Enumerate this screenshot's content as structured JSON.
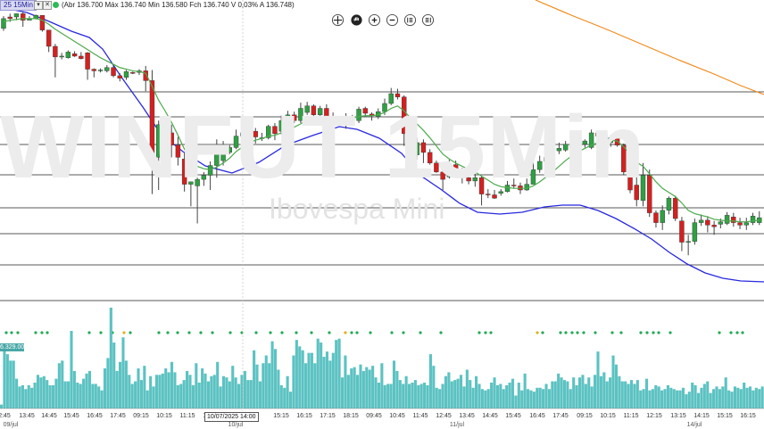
{
  "symbol_label": "WINFUT 15Min",
  "symbol_badge": "25 15Min",
  "ohlc_text": "(Abr 136.700 Máx 136.740 Min 136.580 Fch 136.740 V 0,03% A 136.748)",
  "watermark": "WINFUT 15Min",
  "watermark_sub": "Ibovespa Mini",
  "volume_badge": "6.329.00",
  "cursor_time": "10/07/2025 14:00",
  "toolbar": [
    "move-icon",
    "hand-icon",
    "zoom-in-icon",
    "zoom-out-icon",
    "fit-left-icon",
    "fit-right-icon"
  ],
  "x_ticks": [
    "2:45",
    "13:45",
    "14:45",
    "15:45",
    "16:45",
    "17:45",
    "09:15",
    "10:15",
    "11:15",
    "12:15",
    "14:00",
    "15:15",
    "16:15",
    "17:15",
    "18:15",
    "09:45",
    "10:45",
    "11:45",
    "12:45",
    "13:45",
    "14:45",
    "15:45",
    "16:45",
    "17:45",
    "09:15",
    "10:15",
    "11:15",
    "12:15",
    "13:15",
    "14:15",
    "15:15",
    "16:15"
  ],
  "x_dates": [
    "09/jul",
    "10/jul",
    "11/jul",
    "14/jul"
  ],
  "colors": {
    "up": "#2ea043",
    "down": "#d42020",
    "ma_fast": "#4daa4d",
    "ma_slow": "#2828e0",
    "ma_long": "#f08a1c",
    "volume": "#5cc2c2",
    "dot": "#22aa55",
    "dot_alt": "#e0b020"
  },
  "chart_data": {
    "type": "candlestick",
    "candles": [
      [
        -0.2,
        1.0,
        -0.5,
        1.3
      ],
      [
        1.2,
        1.0,
        0.6,
        1.6
      ],
      [
        1.2,
        1.6,
        0.8,
        1.6
      ],
      [
        1.6,
        0.8,
        0.0,
        1.8
      ],
      [
        0.8,
        1.0,
        0.8,
        1.3
      ],
      [
        1.0,
        1.4,
        0.9,
        1.5
      ],
      [
        1.4,
        -0.4,
        -0.6,
        1.4
      ],
      [
        -0.4,
        -2.4,
        -3.1,
        -0.4
      ],
      [
        -2.4,
        -3.7,
        -6.2,
        -2.1
      ],
      [
        -3.6,
        -3.6,
        -4.0,
        -3.2
      ],
      [
        -3.8,
        -3.1,
        -3.9,
        -2.9
      ],
      [
        -3.3,
        -3.6,
        -3.7,
        -3.0
      ],
      [
        -3.6,
        -3.9,
        -4.0,
        -3.1
      ],
      [
        -3.2,
        -5.2,
        -6.5,
        -3.1
      ],
      [
        -5.2,
        -5.4,
        -6.2,
        -5.1
      ],
      [
        -5.4,
        -5.3,
        -5.6,
        -5.1
      ],
      [
        -5.4,
        -5.0,
        -5.6,
        -4.7
      ],
      [
        -5.0,
        -6.0,
        -6.2,
        -4.7
      ],
      [
        -6.0,
        -6.3,
        -6.7,
        -5.7
      ],
      [
        -6.2,
        -5.5,
        -6.5,
        -5.3
      ],
      [
        -5.6,
        -5.7,
        -5.8,
        -5.5
      ],
      [
        -5.6,
        -5.4,
        -5.9,
        -5.2
      ],
      [
        -5.4,
        -6.6,
        -7.9,
        -4.8
      ],
      [
        -6.6,
        -17.0,
        -20.5,
        -5.3
      ],
      [
        -16.0,
        -12.0,
        -20.0,
        -11.5
      ],
      [
        -12.0,
        -12.8,
        -13.2,
        -11.0
      ],
      [
        -13.0,
        -14.5,
        -16.0,
        -12.0
      ],
      [
        -14.5,
        -16.0,
        -17.0,
        -13.5
      ],
      [
        -16.2,
        -19.3,
        -20.2,
        -15.5
      ],
      [
        -19.3,
        -19.0,
        -22.0,
        -19.0
      ],
      [
        -19.5,
        -18.7,
        -24.1,
        -18.5
      ],
      [
        -18.7,
        -18.2,
        -19.5,
        -17.8
      ],
      [
        -18.2,
        -17.0,
        -20.0,
        -16.5
      ],
      [
        -17.0,
        -15.0,
        -18.5,
        -13.8
      ],
      [
        -16.4,
        -14.9,
        -17.0,
        -14.0
      ],
      [
        -15.4,
        -14.8,
        -15.6,
        -14.5
      ],
      [
        -14.8,
        -13.4,
        -15.0,
        -12.6
      ],
      [
        -13.4,
        -13.0,
        -13.7,
        -12.7
      ],
      [
        -13.5,
        -12.8,
        -13.8,
        -12.5
      ],
      [
        -12.8,
        -13.5,
        -14.3,
        -12.4
      ],
      [
        -13.6,
        -13.6,
        -14.0,
        -13.0
      ],
      [
        -13.6,
        -12.2,
        -13.8,
        -12.0
      ],
      [
        -12.2,
        -13.1,
        -13.9,
        -11.8
      ],
      [
        -12.8,
        -11.5,
        -13.2,
        -10.9
      ],
      [
        -11.5,
        -10.8,
        -11.7,
        -10.3
      ],
      [
        -10.8,
        -11.5,
        -11.8,
        -10.4
      ],
      [
        -11.5,
        -10.0,
        -11.8,
        -9.3
      ],
      [
        -10.5,
        -9.7,
        -10.8,
        -9.2
      ],
      [
        -9.7,
        -10.8,
        -11.3,
        -9.5
      ],
      [
        -10.8,
        -10.0,
        -11.3,
        -9.7
      ],
      [
        -10.0,
        -11.3,
        -11.6,
        -9.5
      ],
      [
        -11.3,
        -11.3,
        -11.8,
        -10.5
      ],
      [
        -11.3,
        -11.6,
        -12.0,
        -11.2
      ],
      [
        -11.6,
        -11.1,
        -12.5,
        -10.6
      ],
      [
        -11.1,
        -11.5,
        -11.8,
        -10.8
      ],
      [
        -11.5,
        -10.1,
        -11.8,
        -9.8
      ],
      [
        -10.0,
        -10.6,
        -11.0,
        -9.8
      ],
      [
        -10.7,
        -10.9,
        -11.5,
        -10.5
      ],
      [
        -11.0,
        -10.4,
        -11.3,
        -10.0
      ],
      [
        -10.4,
        -9.4,
        -10.8,
        -8.8
      ],
      [
        -9.4,
        -8.2,
        -9.6,
        -7.5
      ],
      [
        -8.2,
        -8.6,
        -8.9,
        -7.6
      ],
      [
        -8.6,
        -13.1,
        -14.6,
        -8.4
      ],
      [
        -13.1,
        -15.7,
        -16.0,
        -12.5
      ],
      [
        -15.7,
        -14.2,
        -16.3,
        -13.6
      ],
      [
        -14.2,
        -15.4,
        -16.7,
        -13.8
      ],
      [
        -15.4,
        -16.7,
        -16.9,
        -15.0
      ],
      [
        -16.7,
        -17.8,
        -17.9,
        -16.4
      ],
      [
        -17.8,
        -18.7,
        -20.0,
        -17.5
      ],
      [
        -18.4,
        -16.9,
        -18.6,
        -16.3
      ],
      [
        -16.9,
        -17.5,
        -18.2,
        -16.4
      ],
      [
        -17.5,
        -18.5,
        -19.2,
        -17.3
      ],
      [
        -18.5,
        -18.9,
        -19.3,
        -18.0
      ],
      [
        -18.9,
        -18.5,
        -19.6,
        -18.0
      ],
      [
        -18.5,
        -20.5,
        -21.9,
        -18.3
      ],
      [
        -20.5,
        -20.6,
        -21.0,
        -19.9
      ],
      [
        -20.6,
        -21.0,
        -21.1,
        -20.0
      ],
      [
        -20.4,
        -20.2,
        -20.7,
        -19.9
      ],
      [
        -20.2,
        -19.4,
        -20.3,
        -18.9
      ],
      [
        -19.4,
        -19.5,
        -19.8,
        -18.6
      ],
      [
        -19.5,
        -20.0,
        -20.5,
        -19.1
      ],
      [
        -20.0,
        -19.3,
        -20.1,
        -18.6
      ],
      [
        -19.3,
        -17.5,
        -19.3,
        -16.6
      ],
      [
        -17.5,
        -16.5,
        -17.9,
        -15.8
      ],
      [
        -16.5,
        -16.0,
        -16.8,
        -15.7
      ],
      [
        -16.0,
        -15.2,
        -16.2,
        -14.8
      ],
      [
        -15.2,
        -14.9,
        -15.6,
        -14.2
      ],
      [
        -15.1,
        -14.4,
        -15.3,
        -14.0
      ],
      [
        -14.4,
        -14.8,
        -15.1,
        -14.1
      ],
      [
        -14.8,
        -14.4,
        -15.0,
        -14.2
      ],
      [
        -14.4,
        -14.0,
        -14.8,
        -13.8
      ],
      [
        -14.8,
        -13.0,
        -15.0,
        -12.6
      ],
      [
        -13.0,
        -13.4,
        -13.7,
        -12.8
      ],
      [
        -13.2,
        -14.0,
        -14.3,
        -13.0
      ],
      [
        -14.2,
        -13.6,
        -14.7,
        -13.3
      ],
      [
        -13.6,
        -14.5,
        -14.7,
        -13.2
      ],
      [
        -14.5,
        -17.8,
        -18.2,
        -14.3
      ],
      [
        -17.8,
        -20.0,
        -20.4,
        -17.5
      ],
      [
        -19.4,
        -21.2,
        -22.0,
        -17.0
      ],
      [
        -21.3,
        -18.2,
        -22.0,
        -16.7
      ],
      [
        -18.2,
        -22.8,
        -23.3,
        -17.5
      ],
      [
        -22.8,
        -24.0,
        -24.6,
        -22.5
      ],
      [
        -24.0,
        -22.5,
        -24.9,
        -21.9
      ],
      [
        -22.5,
        -21.0,
        -23.0,
        -20.8
      ],
      [
        -21.0,
        -23.5,
        -23.8,
        -20.7
      ],
      [
        -23.8,
        -26.4,
        -27.5,
        -23.3
      ],
      [
        -26.4,
        -26.3,
        -28.0,
        -25.5
      ],
      [
        -26.3,
        -24.0,
        -26.7,
        -23.5
      ],
      [
        -24.0,
        -23.7,
        -24.4,
        -23.0
      ],
      [
        -23.7,
        -24.3,
        -25.2,
        -23.2
      ],
      [
        -24.3,
        -24.5,
        -25.5,
        -23.8
      ],
      [
        -24.2,
        -23.9,
        -24.7,
        -23.5
      ],
      [
        -24.1,
        -23.1,
        -24.3,
        -22.7
      ],
      [
        -23.3,
        -24.0,
        -24.5,
        -22.8
      ],
      [
        -24.0,
        -24.3,
        -24.8,
        -23.4
      ],
      [
        -24.3,
        -24.0,
        -24.9,
        -23.4
      ],
      [
        -24.0,
        -23.2,
        -24.3,
        -22.8
      ],
      [
        -24.0,
        -23.4,
        -24.3,
        -22.6
      ]
    ],
    "ma_fast": [
      0.6,
      0.8,
      0.9,
      1.0,
      1.0,
      1.0,
      0.8,
      0.3,
      -0.3,
      -0.8,
      -1.3,
      -1.8,
      -2.3,
      -2.8,
      -3.3,
      -3.8,
      -4.2,
      -4.6,
      -5.0,
      -5.2,
      -5.4,
      -5.5,
      -5.7,
      -7.3,
      -9.0,
      -10.3,
      -11.7,
      -13.3,
      -15.0,
      -16.3,
      -17.1,
      -17.4,
      -17.5,
      -17.2,
      -16.7,
      -16.1,
      -15.3,
      -14.7,
      -14.2,
      -13.9,
      -13.7,
      -13.4,
      -13.3,
      -13.0,
      -12.6,
      -12.3,
      -11.9,
      -11.4,
      -11.2,
      -11.0,
      -11.0,
      -11.0,
      -11.1,
      -11.1,
      -11.2,
      -11.0,
      -10.9,
      -10.9,
      -10.8,
      -10.5,
      -10.0,
      -9.7,
      -10.3,
      -11.2,
      -11.9,
      -12.7,
      -13.6,
      -14.6,
      -15.6,
      -16.2,
      -16.7,
      -17.1,
      -17.5,
      -17.8,
      -18.3,
      -18.8,
      -19.3,
      -19.6,
      -19.7,
      -19.8,
      -19.8,
      -19.8,
      -19.5,
      -19.0,
      -18.4,
      -17.8,
      -17.1,
      -16.4,
      -15.8,
      -15.3,
      -14.9,
      -14.5,
      -14.2,
      -14.0,
      -13.9,
      -14.0,
      -14.7,
      -15.6,
      -16.6,
      -17.1,
      -18.0,
      -19.0,
      -19.8,
      -20.3,
      -20.8,
      -21.6,
      -22.5,
      -22.9,
      -23.1,
      -23.3,
      -23.6,
      -23.7,
      -23.8,
      -23.8,
      -23.9,
      -23.9,
      -23.8,
      -23.7
    ]
  },
  "ma_slow_curve": [
    [
      0,
      8
    ],
    [
      30,
      14
    ],
    [
      55,
      24
    ],
    [
      80,
      35
    ],
    [
      100,
      42
    ],
    [
      115,
      55
    ],
    [
      135,
      85
    ],
    [
      160,
      120
    ],
    [
      180,
      150
    ],
    [
      205,
      170
    ],
    [
      230,
      186
    ],
    [
      260,
      194
    ],
    [
      290,
      182
    ],
    [
      320,
      163
    ],
    [
      350,
      152
    ],
    [
      380,
      142
    ],
    [
      400,
      145
    ],
    [
      425,
      155
    ],
    [
      450,
      172
    ],
    [
      470,
      196
    ],
    [
      495,
      213
    ],
    [
      515,
      228
    ],
    [
      535,
      238
    ],
    [
      560,
      240
    ],
    [
      585,
      238
    ],
    [
      610,
      232
    ],
    [
      630,
      230
    ],
    [
      650,
      230
    ],
    [
      670,
      236
    ],
    [
      690,
      245
    ],
    [
      710,
      256
    ],
    [
      730,
      268
    ],
    [
      750,
      283
    ],
    [
      770,
      296
    ],
    [
      790,
      306
    ],
    [
      810,
      312
    ],
    [
      830,
      315
    ],
    [
      856,
      316
    ]
  ],
  "ma_long_curve": [
    [
      600,
      0
    ],
    [
      640,
      17
    ],
    [
      680,
      33
    ],
    [
      720,
      50
    ],
    [
      760,
      67
    ],
    [
      800,
      83
    ],
    [
      830,
      96
    ],
    [
      856,
      106
    ]
  ],
  "hlines": [
    103,
    131,
    162,
    196,
    233,
    262,
    297,
    337
  ],
  "volumes": [
    3,
    47,
    42,
    37,
    37,
    23,
    17,
    18,
    15,
    18,
    16,
    20,
    26,
    24,
    25,
    22,
    18,
    18,
    23,
    35,
    37,
    21,
    21,
    60,
    29,
    20,
    19,
    23,
    27,
    29,
    19,
    19,
    17,
    14,
    31,
    39,
    78,
    51,
    29,
    36,
    55,
    37,
    26,
    19,
    21,
    31,
    22,
    33,
    14,
    25,
    17,
    26,
    26,
    27,
    31,
    28,
    36,
    28,
    18,
    19,
    22,
    29,
    26,
    18,
    35,
    20,
    31,
    27,
    21,
    25,
    26,
    36,
    17,
    25,
    24,
    21,
    33,
    24,
    19,
    26,
    29,
    22,
    22,
    45,
    34,
    21,
    35,
    41,
    35,
    52,
    46,
    30,
    18,
    16,
    25,
    13,
    41,
    53,
    48,
    45,
    35,
    43,
    43,
    35,
    54,
    51,
    40,
    44,
    37,
    43,
    53,
    54,
    24,
    41,
    26,
    31,
    32,
    26,
    34,
    29,
    32,
    30,
    33,
    24,
    20,
    35,
    18,
    19,
    19,
    37,
    29,
    22,
    19,
    25,
    19,
    20,
    22,
    18,
    19,
    20,
    18,
    42,
    33,
    16,
    15,
    19,
    25,
    28,
    21,
    22,
    23,
    26,
    17,
    30,
    22,
    16,
    25,
    19,
    15,
    14,
    15,
    20,
    24,
    18,
    19,
    15,
    18,
    20,
    23,
    10,
    20,
    14,
    27,
    15,
    14,
    13,
    16,
    16,
    15,
    19,
    15,
    21,
    21,
    27,
    24,
    22,
    21,
    15,
    24,
    18,
    24,
    26,
    19,
    24,
    17,
    26,
    44,
    25,
    28,
    21,
    24,
    41,
    34,
    25,
    21,
    21,
    19,
    22,
    19,
    22,
    14,
    15,
    23,
    14,
    15,
    18,
    17,
    14,
    15,
    18,
    16,
    15,
    14,
    14,
    16,
    11,
    13,
    20,
    18,
    12,
    16,
    19,
    21,
    12,
    15,
    17,
    15,
    17,
    24,
    14,
    13,
    17,
    16,
    15,
    20,
    16,
    17,
    14,
    16,
    15,
    17
  ],
  "signal_dots": [
    [
      7,
      "g"
    ],
    [
      13,
      "g"
    ],
    [
      20,
      "g"
    ],
    [
      40,
      "g"
    ],
    [
      47,
      "g"
    ],
    [
      53,
      "g"
    ],
    [
      100,
      "g"
    ],
    [
      113,
      "g"
    ],
    [
      126,
      "g"
    ],
    [
      139,
      "y"
    ],
    [
      146,
      "g"
    ],
    [
      178,
      "g"
    ],
    [
      188,
      "g"
    ],
    [
      199,
      "g"
    ],
    [
      212,
      "g"
    ],
    [
      225,
      "g"
    ],
    [
      238,
      "g"
    ],
    [
      258,
      "g"
    ],
    [
      271,
      "g"
    ],
    [
      287,
      "g"
    ],
    [
      303,
      "g"
    ],
    [
      316,
      "g"
    ],
    [
      332,
      "g"
    ],
    [
      349,
      "g"
    ],
    [
      369,
      "g"
    ],
    [
      387,
      "y"
    ],
    [
      394,
      "g"
    ],
    [
      400,
      "g"
    ],
    [
      415,
      "g"
    ],
    [
      439,
      "g"
    ],
    [
      452,
      "g"
    ],
    [
      471,
      "g"
    ],
    [
      494,
      "g"
    ],
    [
      537,
      "g"
    ],
    [
      544,
      "g"
    ],
    [
      550,
      "g"
    ],
    [
      602,
      "y"
    ],
    [
      608,
      "g"
    ],
    [
      628,
      "g"
    ],
    [
      634,
      "g"
    ],
    [
      641,
      "g"
    ],
    [
      647,
      "g"
    ],
    [
      654,
      "g"
    ],
    [
      667,
      "g"
    ],
    [
      686,
      "g"
    ],
    [
      696,
      "g"
    ],
    [
      718,
      "g"
    ],
    [
      725,
      "g"
    ],
    [
      732,
      "g"
    ],
    [
      738,
      "g"
    ],
    [
      751,
      "g"
    ],
    [
      806,
      "g"
    ],
    [
      819,
      "g"
    ],
    [
      826,
      "g"
    ],
    [
      832,
      "g"
    ]
  ]
}
